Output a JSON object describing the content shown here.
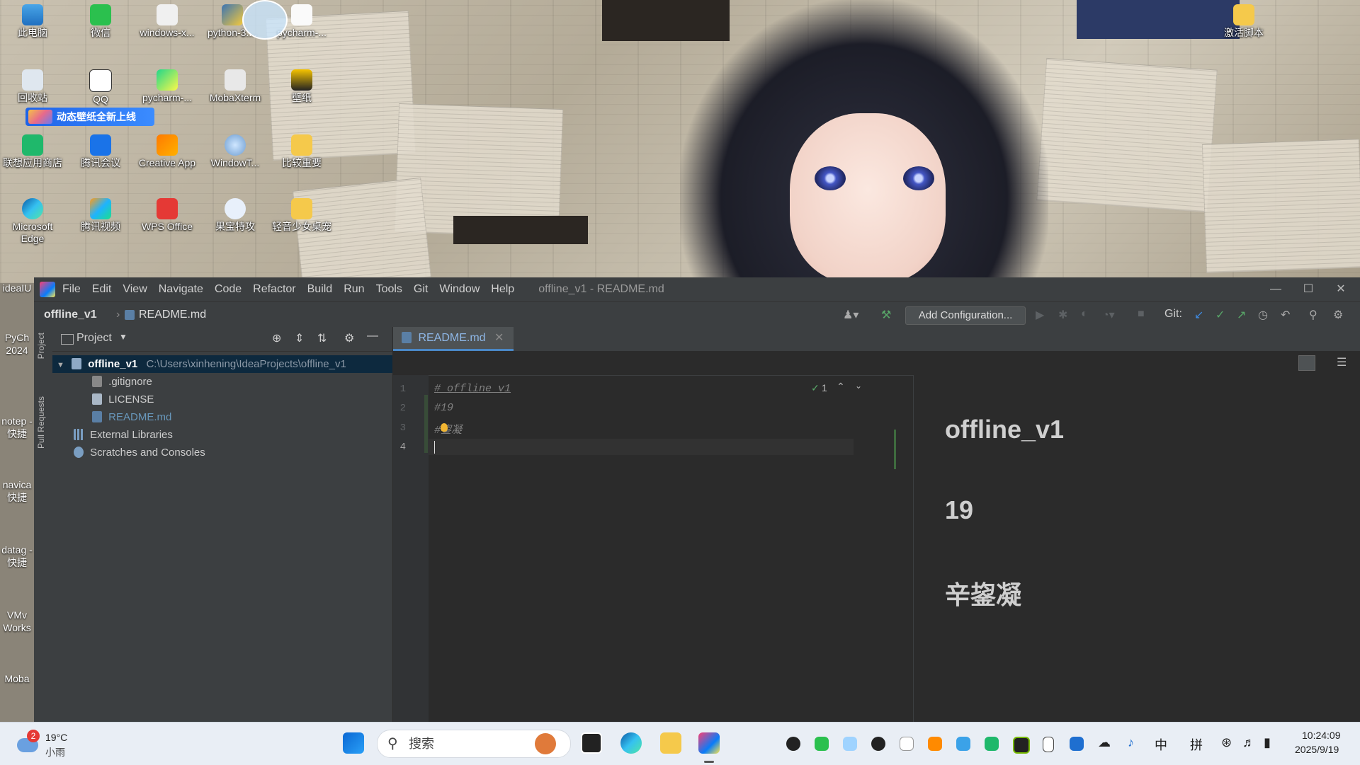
{
  "desktop": {
    "icons": [
      {
        "label": "此电脑",
        "icon": "computer-icon"
      },
      {
        "label": "微信",
        "icon": "wechat-icon"
      },
      {
        "label": "windows-x...",
        "icon": "file-icon"
      },
      {
        "label": "python-3....",
        "icon": "python-installer-icon"
      },
      {
        "label": "pycharm-...",
        "icon": "file-icon"
      },
      {
        "label": "回收站",
        "icon": "recycle-bin-icon"
      },
      {
        "label": "QQ",
        "icon": "qq-icon"
      },
      {
        "label": "pycharm-...",
        "icon": "pycharm-icon"
      },
      {
        "label": "MobaXterm",
        "icon": "mobaxterm-icon"
      },
      {
        "label": "壁纸",
        "icon": "wallpaper-icon"
      },
      {
        "label": "联想应用商店",
        "icon": "lenovo-store-icon"
      },
      {
        "label": "腾讯会议",
        "icon": "tencent-meeting-icon"
      },
      {
        "label": "Creative App",
        "icon": "creative-app-icon"
      },
      {
        "label": "WindowT...",
        "icon": "window-tool-icon"
      },
      {
        "label": "比较重要",
        "icon": "folder-icon"
      },
      {
        "label": "Microsoft Edge",
        "icon": "edge-icon"
      },
      {
        "label": "腾讯视频",
        "icon": "tencent-video-icon"
      },
      {
        "label": "WPS Office",
        "icon": "wps-icon"
      },
      {
        "label": "果宝特攻",
        "icon": "rocket-icon"
      },
      {
        "label": "轻音少女桌宠",
        "icon": "folder-icon"
      },
      {
        "label": "激活脚本",
        "icon": "folder-icon"
      }
    ],
    "side_icons": [
      "ideaIU",
      "PyCh 2024",
      "notep - 快捷",
      "navica 快捷",
      "datag - 快捷",
      "VMv Works",
      "Moba"
    ],
    "banner": "动态壁纸全新上线"
  },
  "ide": {
    "menu": [
      "File",
      "Edit",
      "View",
      "Navigate",
      "Code",
      "Refactor",
      "Build",
      "Run",
      "Tools",
      "Git",
      "Window",
      "Help"
    ],
    "window_title": "offline_v1 - README.md",
    "breadcrumb": {
      "project": "offline_v1",
      "file": "README.md"
    },
    "add_configuration": "Add Configuration...",
    "git_label": "Git:",
    "side_tabs": {
      "project": "Project",
      "pull_requests": "Pull Requests"
    },
    "project_panel": {
      "title": "Project",
      "root_name": "offline_v1",
      "root_path": "C:\\Users\\xinhening\\IdeaProjects\\offline_v1",
      "files": [
        ".gitignore",
        "LICENSE",
        "README.md"
      ],
      "external": "External Libraries",
      "scratches": "Scratches and Consoles"
    },
    "editor_tab": "README.md",
    "inspection_count": "1",
    "code_lines": [
      {
        "num": "1",
        "text": "# offline_v1"
      },
      {
        "num": "2",
        "text": "#19"
      },
      {
        "num": "3",
        "text": "#鋆凝"
      },
      {
        "num": "4",
        "text": ""
      }
    ],
    "preview": {
      "h1": "offline_v1",
      "h2": "19",
      "h3": "辛鋆凝"
    }
  },
  "taskbar": {
    "weather_temp": "19°C",
    "weather_desc": "小雨",
    "weather_badge": "2",
    "search_placeholder": "搜索",
    "tray_lang": "中",
    "tray_ime": "拼",
    "time": "10:24:09",
    "date": "2025/9/19"
  }
}
